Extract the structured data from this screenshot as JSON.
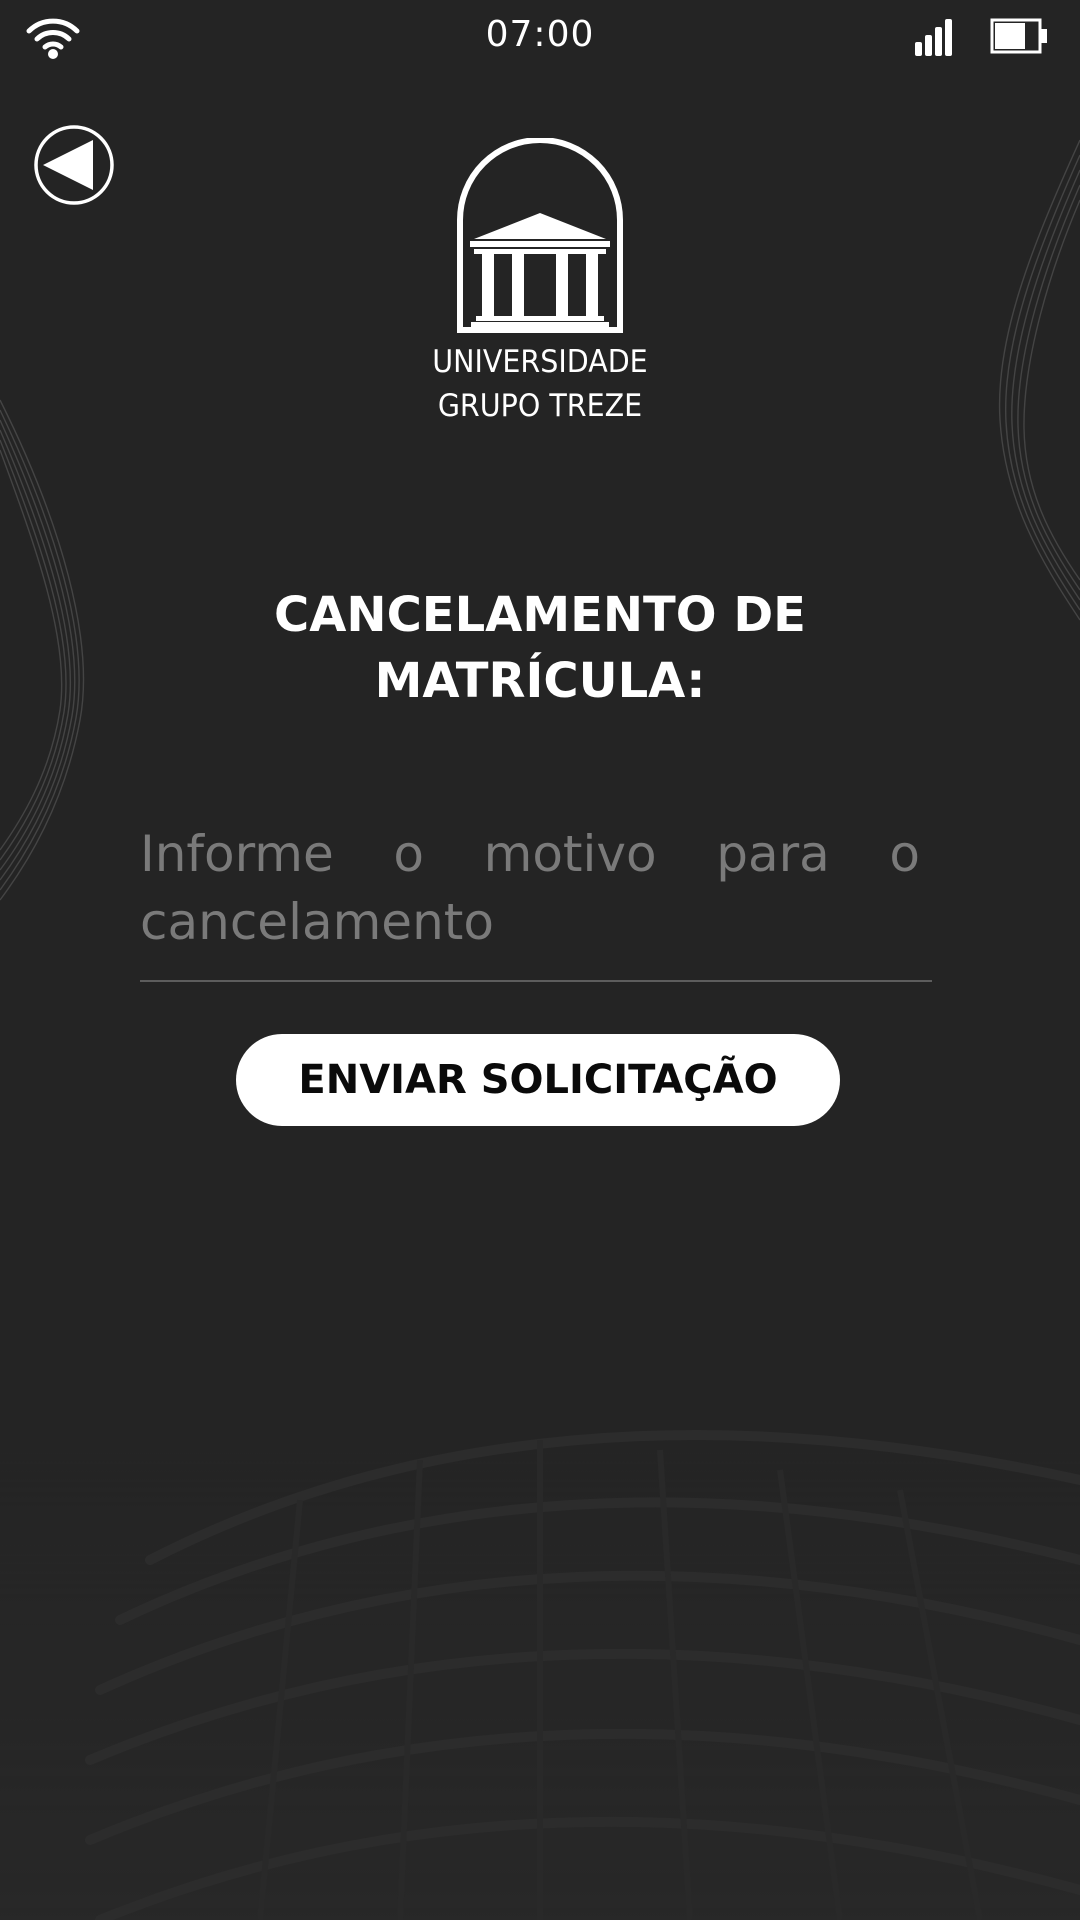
{
  "status_bar": {
    "time": "07:00",
    "icons": [
      "wifi-icon",
      "signal-icon",
      "battery-icon"
    ]
  },
  "navigation": {
    "back_icon": "back-arrow-icon"
  },
  "logo": {
    "icon": "university-building-icon",
    "line1": "UNIVERSIDADE",
    "line2": "GRUPO TREZE"
  },
  "form": {
    "title_line1": "CANCELAMENTO DE",
    "title_line2": "MATRÍCULA:",
    "reason_placeholder": "Informe o motivo para o cancelamento",
    "submit_label": "ENVIAR SOLICITAÇÃO"
  },
  "colors": {
    "background": "#242424",
    "text": "#ffffff",
    "placeholder": "#7a7a7a",
    "button_bg": "#ffffff",
    "button_text": "#0a0a0a"
  }
}
